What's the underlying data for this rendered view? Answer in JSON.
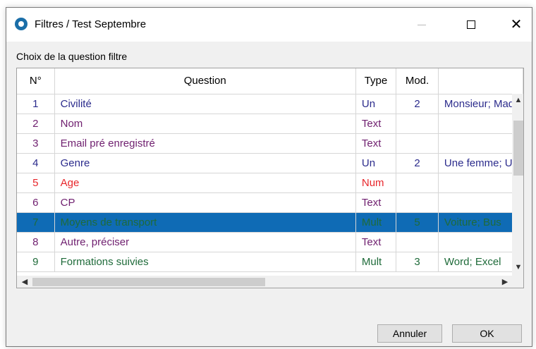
{
  "window": {
    "title": "Filtres / Test Septembre"
  },
  "section": {
    "label": "Choix de la question filtre"
  },
  "table": {
    "headers": [
      "N°",
      "Question",
      "Type",
      "Mod.",
      ""
    ],
    "rows": [
      {
        "n": "1",
        "question": "Civilité",
        "type": "Un",
        "mod": "2",
        "values": "Monsieur; Mad",
        "color": "#2b2b8c",
        "selected": false
      },
      {
        "n": "2",
        "question": "Nom",
        "type": "Text",
        "mod": "",
        "values": "",
        "color": "#6f1f6f",
        "selected": false
      },
      {
        "n": "3",
        "question": "Email pré enregistré",
        "type": "Text",
        "mod": "",
        "values": "",
        "color": "#6f1f6f",
        "selected": false
      },
      {
        "n": "4",
        "question": "Genre",
        "type": "Un",
        "mod": "2",
        "values": "Une femme; Un",
        "color": "#2b2b8c",
        "selected": false
      },
      {
        "n": "5",
        "question": "Age",
        "type": "Num",
        "mod": "",
        "values": "",
        "color": "#e8262b",
        "selected": false
      },
      {
        "n": "6",
        "question": "CP",
        "type": "Text",
        "mod": "",
        "values": "",
        "color": "#6f1f6f",
        "selected": false
      },
      {
        "n": "7",
        "question": "Moyens de transport",
        "type": "Mult",
        "mod": "5",
        "values": "Voiture; Bus",
        "color": "#1f6b3a",
        "selected": true
      },
      {
        "n": "8",
        "question": "Autre, préciser",
        "type": "Text",
        "mod": "",
        "values": "",
        "color": "#6f1f6f",
        "selected": false
      },
      {
        "n": "9",
        "question": "Formations suivies",
        "type": "Mult",
        "mod": "3",
        "values": "Word; Excel",
        "color": "#1f6b3a",
        "selected": false
      }
    ]
  },
  "buttons": {
    "cancel": "Annuler",
    "ok": "OK"
  },
  "icons": {
    "app": "app-logo-icon",
    "minimize": "minimize-icon",
    "maximize": "maximize-icon",
    "close": "close-icon"
  },
  "colors": {
    "selection": "#0f6bb5",
    "titlebar": "#ffffff",
    "dialog_bg": "#f0f0f0"
  }
}
